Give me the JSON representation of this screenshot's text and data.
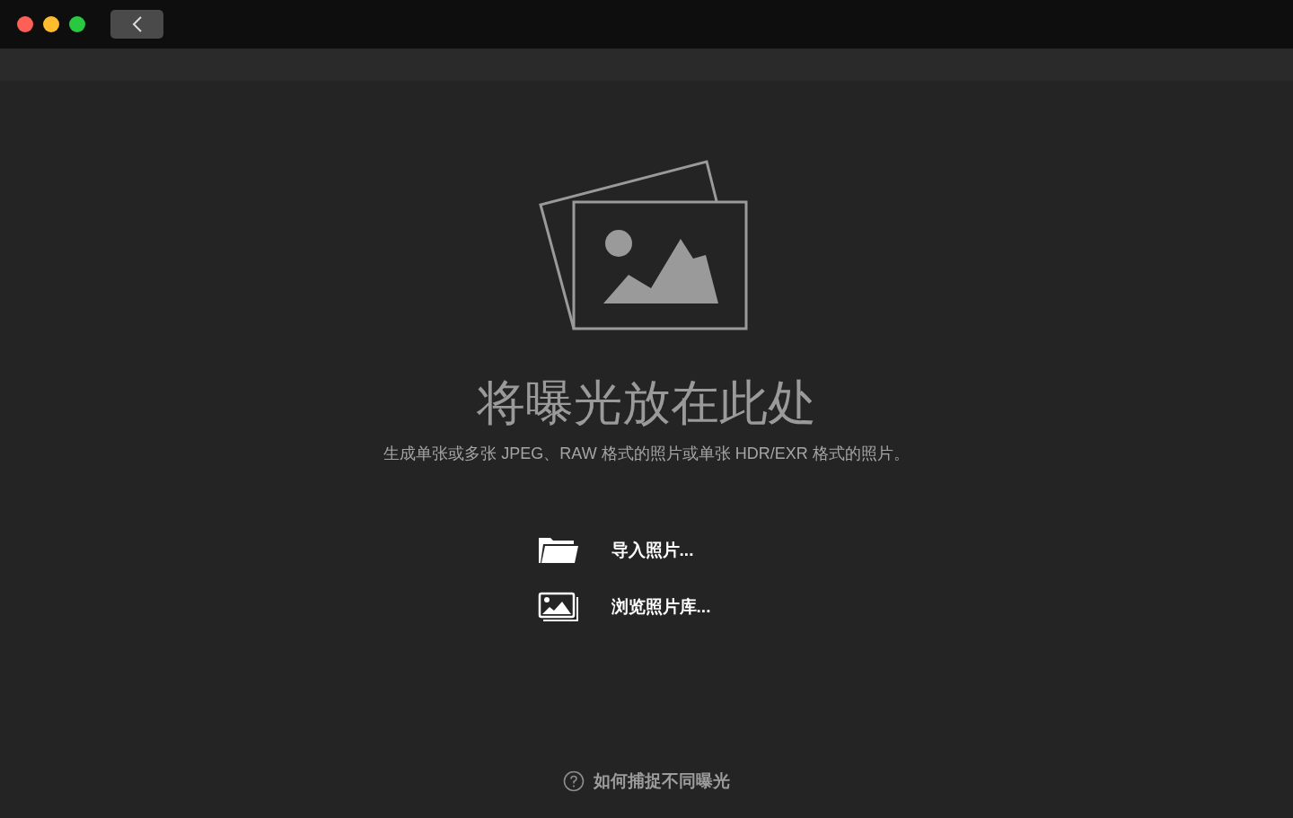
{
  "drop_zone": {
    "title": "将曝光放在此处",
    "subtitle": "生成单张或多张 JPEG、RAW 格式的照片或单张 HDR/EXR 格式的照片。"
  },
  "actions": [
    {
      "kind": "folder",
      "label": "导入照片..."
    },
    {
      "kind": "library",
      "label": "浏览照片库..."
    }
  ],
  "help_link": "如何捕捉不同曝光"
}
